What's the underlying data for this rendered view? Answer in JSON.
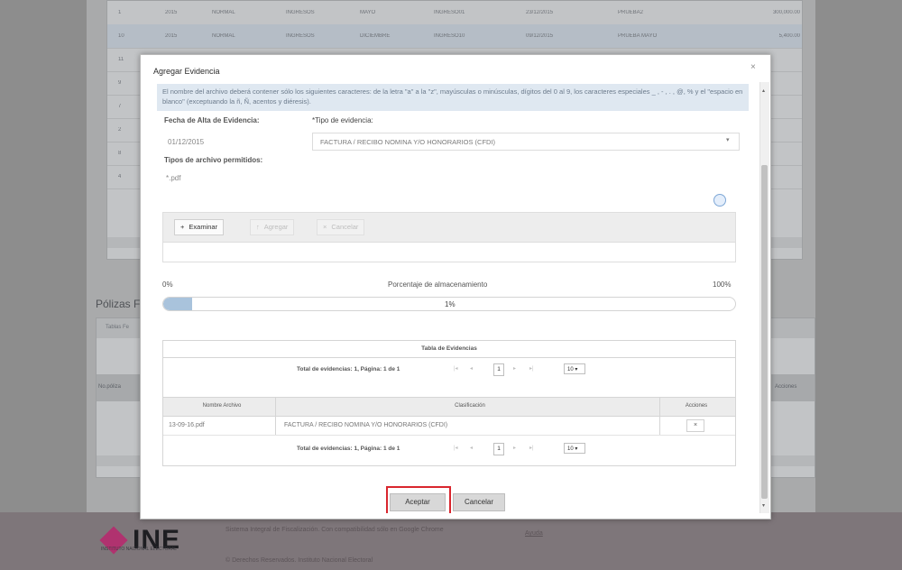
{
  "background": {
    "rows": [
      {
        "cells": [
          "1",
          "2015",
          "NORMAL",
          "INGRESOS",
          "MAYO",
          "INGRESO01",
          "23/12/2015",
          "PRUEBA2",
          "300,000.00"
        ]
      },
      {
        "cells": [
          "10",
          "2015",
          "NORMAL",
          "INGRESOS",
          "DICIEMBRE",
          "INGRESO10",
          "09/12/2015",
          "PRUEBA MAYO",
          "5,400.00"
        ]
      },
      {
        "cells": [
          "11"
        ]
      },
      {
        "cells": [
          "9"
        ]
      },
      {
        "cells": [
          "7"
        ]
      },
      {
        "cells": [
          "2"
        ]
      },
      {
        "cells": [
          "8"
        ]
      },
      {
        "cells": [
          "4"
        ]
      }
    ],
    "section_title": "Pólizas F",
    "grid2_header": "Tablas Fe",
    "grid2_col_left": "No.póliza",
    "grid2_col_right": "Acciones",
    "logo_text": "INE",
    "logo_subtitle": "INSTITUTO NACIONAL ELECTORAL",
    "footer_line1": "Sistema Integral de Fiscalización. Con compatibilidad sólo en Google Chrome",
    "footer_line2": "© Derechos Reservados. Instituto Nacional Electoral",
    "footer_link": "Ayuda"
  },
  "modal": {
    "title": "Agregar Evidencia",
    "close": "×",
    "notice": "El nombre del archivo deberá contener sólo los siguientes caracteres: de la letra \"a\" a la \"z\", mayúsculas o minúsculas, dígitos del 0 al 9, los caracteres especiales _ , - , . , @, % y el \"espacio en blanco\" (exceptuando la ñ, Ñ, acentos y diéresis).",
    "fecha_label": "Fecha de Alta de Evidencia:",
    "fecha_value": "01/12/2015",
    "tipo_label": "*Tipo de evidencia:",
    "tipo_value": "FACTURA / RECIBO NOMINA Y/O HONORARIOS (CFDI)",
    "archivos_label": "Tipos de archivo permitidos:",
    "archivos_value": "*.pdf",
    "uploader": {
      "browse": "Examinar",
      "upload": "Agregar",
      "cancel": "Cancelar"
    },
    "progress": {
      "min_label": "0%",
      "title": "Porcentaje de almacenamiento",
      "max_label": "100%",
      "value": 0.01,
      "value_label": "1%"
    },
    "table": {
      "caption": "Tabla de Evidencias",
      "pager_text": "Total de evidencias: 1, Página: 1 de 1",
      "current_page": "1",
      "rows_per_page": "10 ▾",
      "columns": [
        "Nombre Archivo",
        "Clasificación",
        "Acciones"
      ],
      "rows": [
        {
          "file": "13-09-16.pdf",
          "classification": "FACTURA / RECIBO NOMINA Y/O HONORARIOS (CFDI)",
          "action": "×"
        }
      ]
    },
    "buttons": {
      "accept": "Aceptar",
      "cancel": "Cancelar"
    }
  }
}
